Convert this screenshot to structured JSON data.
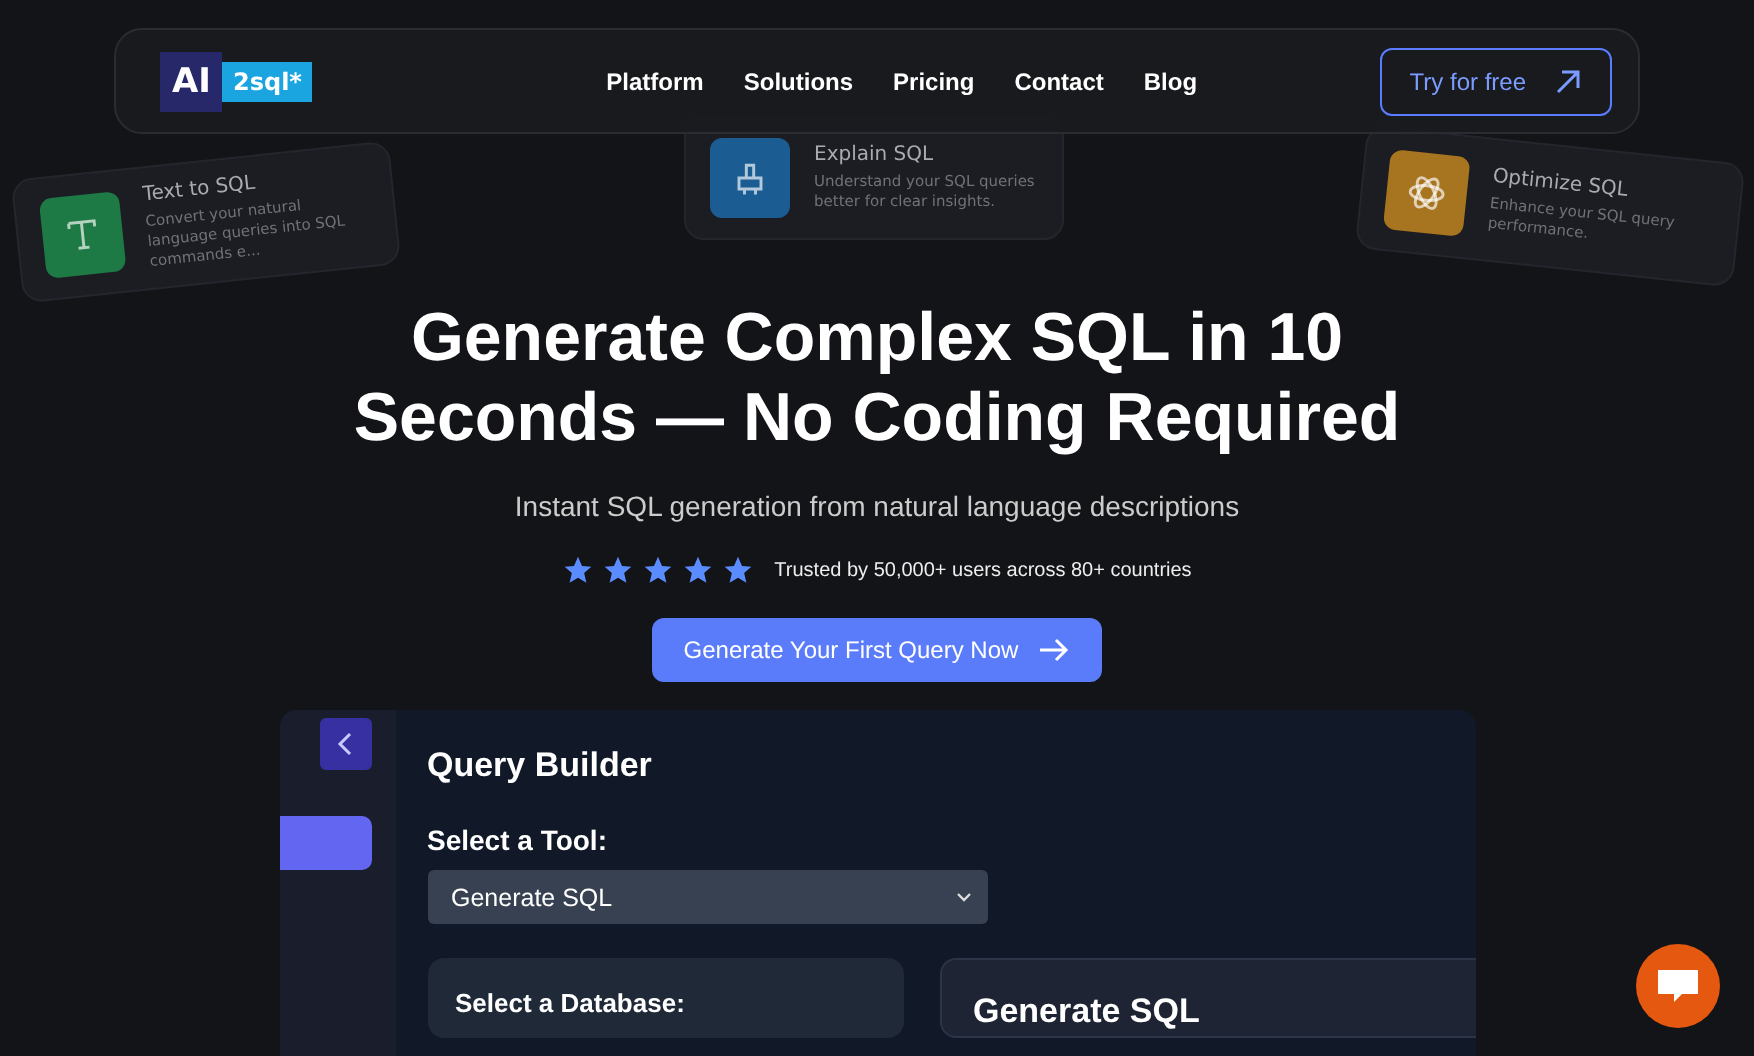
{
  "nav": {
    "logo": {
      "left": "AI",
      "right": "2sql*"
    },
    "links": [
      "Platform",
      "Solutions",
      "Pricing",
      "Contact",
      "Blog"
    ],
    "cta": "Try for free"
  },
  "bg_cards": [
    {
      "kind": "type",
      "title": "Text to SQL",
      "desc": "Convert your natural language queries into SQL commands e...",
      "color": "#1e7a44"
    },
    {
      "kind": "brush",
      "title": "Explain SQL",
      "desc": "Understand your SQL queries better for clear insights.",
      "color": "#1b5d92"
    },
    {
      "kind": "atom",
      "title": "Optimize SQL",
      "desc": "Enhance your SQL query performance.",
      "color": "#a77420"
    }
  ],
  "hero": {
    "title": "Generate Complex SQL in 10 Seconds — No Coding Required",
    "subtitle": "Instant SQL generation from natural language descriptions",
    "stars": 5,
    "trust": "Trusted by 50,000+ users across 80+ countries",
    "cta": "Generate Your First Query Now"
  },
  "builder": {
    "title": "Query Builder",
    "tool_label": "Select a Tool:",
    "tool_value": "Generate SQL",
    "sidebar_items": [
      {
        "selected": true
      }
    ],
    "db_label": "Select a Database:",
    "output_title": "Generate SQL"
  }
}
